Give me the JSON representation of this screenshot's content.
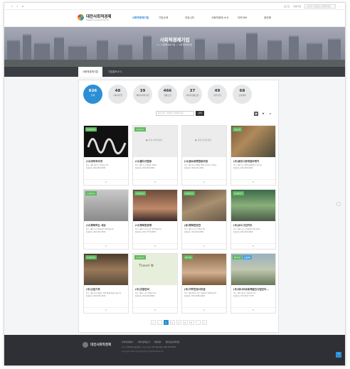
{
  "util": {
    "left": [
      "▾",
      "f",
      "⊕"
    ],
    "right": [
      "로그인",
      "회원가입"
    ],
    "search_placeholder": "검색 및 기업명을 검색해주세요"
  },
  "header": {
    "logo_title": "대전사회적경제",
    "logo_sub": "Daejeon Social Economy",
    "nav": [
      "사회적경제기업",
      "기업소개",
      "커뮤니티",
      "사회적경제 소식",
      "아카이브",
      "참여형"
    ]
  },
  "banner": {
    "title": "사회적경제기업",
    "crumb": "⌂ > 사회적경제기업 > 사회적경제기업"
  },
  "tabs": [
    "사회적경제기업",
    "기업홍보소식"
  ],
  "categories": [
    {
      "count": "626",
      "label": "전체"
    },
    {
      "count": "48",
      "label": "사회적기업"
    },
    {
      "count": "39",
      "label": "예비사회적기업"
    },
    {
      "count": "466",
      "label": "협동조합"
    },
    {
      "count": "37",
      "label": "사회적협동조합"
    },
    {
      "count": "49",
      "label": "마을기업"
    },
    {
      "count": "68",
      "label": "소셜벤처"
    }
  ],
  "search": {
    "placeholder": "회원 유사 기업명을 검색해주세요",
    "button": "검색"
  },
  "views": [
    "▦",
    "▼",
    "≡"
  ],
  "items": [
    {
      "tag": "사회적기업",
      "tag2": "",
      "name": "(사)대덕우리것",
      "info1": "주소: 대전 대덕구 신탄진로 23",
      "info2": "전화번호: 042-000-0000"
    },
    {
      "tag": "사회적기업",
      "tag2": "",
      "name": "(사)둘다섯협동",
      "info1": "주소: 대전 동구 중앙로 200-1",
      "info2": "전화번호: 042-000-0000"
    },
    {
      "tag": "",
      "tag2": "",
      "name": "(사)꿈씨동행협동조합",
      "info1": "주소: 대전 중구 계룡로 825 모르옥스 401호",
      "info2": "전화번호: 042-221-0000"
    },
    {
      "tag": "마을기업",
      "tag2": "",
      "name": "(주)중앙시장취업마켓가",
      "info1": "주소: 대전 동구 중앙시장중앙로 10-1층",
      "info2": "전화번호: 042-000-0000"
    },
    {
      "tag": "사회적기업",
      "tag2": "",
      "name": "(사)행복하는 세상",
      "info1": "주소: 대전 서구 대덕대로 223번길 15",
      "info2": "전화번호: 042-000-7000"
    },
    {
      "tag": "사회적기업",
      "tag2": "",
      "name": "(사)행복한동행",
      "info1": "주소: 대전 서구 둔산로 167번길 5층",
      "info2": "전화번호: 010-7727-9678"
    },
    {
      "tag": "사회적기업",
      "tag2": "",
      "name": "(유)행복한반찬",
      "info1": "주소: 대전시 동구 동편로 82",
      "info2": "전화번호: 042-622-0000"
    },
    {
      "tag": "사회적기업",
      "tag2": "",
      "name": "(주)JSC그린키드",
      "info1": "주소: 대전시 동구 대전천로 60 미2층",
      "info2": "전화번호: 042-000-0000"
    },
    {
      "tag": "사회적기업",
      "tag2": "",
      "name": "(주)산업기프",
      "info1": "주소: 대전 중구 대흥로 140 맨하탄빌딩 지하 1층",
      "info2": "전화번호: 042-000-1234"
    },
    {
      "tag": "사회적기업",
      "tag2": "",
      "name": "(주)굿걸린버",
      "info1": "주소: 대전시 동구 중앙로 2층",
      "info2": "전화번호: 042-000-0000"
    },
    {
      "tag": "예비기업",
      "tag2": "",
      "name": "(주)가하천생사조금",
      "info1": "주소: 대전광역시 서구 유성대로 282번길 22",
      "info2": "전화번호: 070-4000-0000"
    },
    {
      "tag": "예비기업",
      "tag2": "소셜벤처",
      "name": "(주)대나무공동체법인사업단이…",
      "info1": "주소: 대전 대덕구 신탄진로 22",
      "info2": "전화번호: 070-8227-7776"
    }
  ],
  "pager": [
    "«",
    "‹",
    "1",
    "2",
    "3",
    "4",
    "5",
    "›",
    "»"
  ],
  "footer": {
    "logo": "대전사회적경제",
    "links": [
      "사회적경제란?",
      "사회적경제소식",
      "이용약관",
      "개인정보처리방침"
    ],
    "addr": "주소: [35240] 대전광역시 서구 둔산로 123 대표전화: 042-270-0000",
    "copy": "Copyright 2019 대전사회적경제 All Rights Reserved"
  },
  "colors": {
    "accent": "#2c8fd6",
    "footer": "#2e3035",
    "tag_green": "#5cb85c"
  }
}
